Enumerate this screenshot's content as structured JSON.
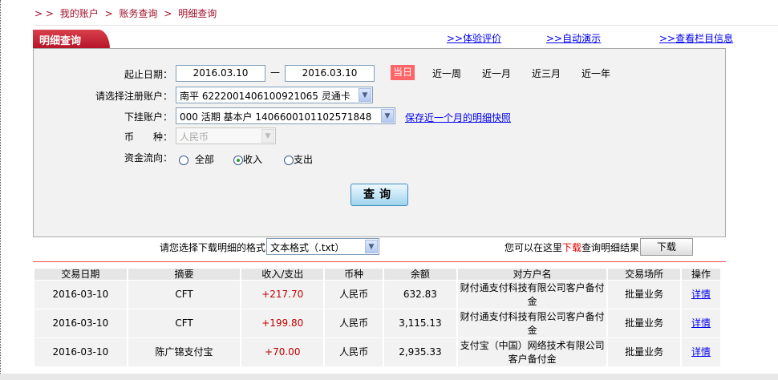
{
  "breadcrumb": {
    "prefix": "> >",
    "items": [
      "我的账户",
      "账务查询",
      "明细查询"
    ]
  },
  "tab_title": "明细查询",
  "top_links": [
    ">>体验评价",
    ">>自动演示",
    ">>查看栏目信息"
  ],
  "form": {
    "date_label": "起止日期：",
    "start_date": "2016.03.10",
    "dash": "—",
    "end_date": "2016.03.10",
    "quick_ranges": [
      "当日",
      "近一周",
      "近一月",
      "近三月",
      "近一年"
    ],
    "active_range": "当日",
    "account_label": "请选择注册账户：",
    "account_value": "南平 6222001406100921065 灵通卡",
    "sub_account_label": "下挂账户：",
    "sub_account_value": "000 活期 基本户 1406600101102571848",
    "snapshot_link": "保存近一个月的明细快照",
    "currency_label": "币　　种：",
    "currency_value": "人民币",
    "flow_label": "资金流向：",
    "flow_options": [
      "全部",
      "收入",
      "支出"
    ],
    "flow_selected": "收入",
    "query_button": "查询"
  },
  "download": {
    "format_label": "请您选择下载明细的格式",
    "format_value": "文本格式（.txt）",
    "hint_pre": "您可以在这里",
    "hint_red": "下载",
    "hint_post": "查询明细结果",
    "button": "下载"
  },
  "table": {
    "headers": [
      "交易日期",
      "摘要",
      "收入/支出",
      "币种",
      "余额",
      "对方户名",
      "交易场所",
      "操作"
    ],
    "rows": [
      [
        "2016-03-10",
        "CFT",
        "+217.70",
        "人民币",
        "632.83",
        "财付通支付科技有限公司客户备付金",
        "批量业务",
        "详情"
      ],
      [
        "2016-03-10",
        "CFT",
        "+199.80",
        "人民币",
        "3,115.13",
        "财付通支付科技有限公司客户备付金",
        "批量业务",
        "详情"
      ],
      [
        "2016-03-10",
        "陈广锦支付宝",
        "+70.00",
        "人民币",
        "2,935.33",
        "支付宝（中国）网络技术有限公司客户备付金",
        "批量业务",
        "详情"
      ]
    ]
  },
  "colors": {
    "brand_red": "#b51426",
    "today_badge": "#ff6469",
    "income": "#c00000",
    "link": "#0000ee"
  }
}
